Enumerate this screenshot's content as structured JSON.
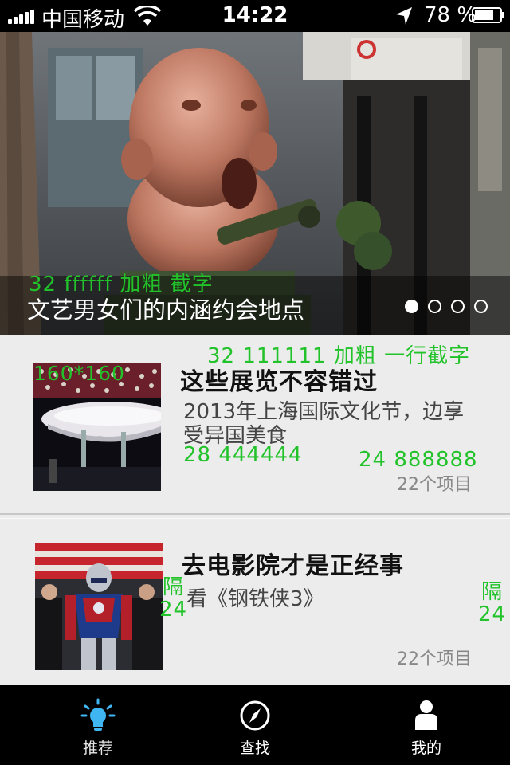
{
  "status_bar": {
    "carrier": "中国移动",
    "time": "14:22",
    "battery": "78 %"
  },
  "banner": {
    "note": "32 ffffff 加粗 截字",
    "title": "文艺男女们的内涵约会地点",
    "page_count": 4,
    "active_page": 1
  },
  "list": {
    "items": [
      {
        "title": "这些展览不容错过",
        "desc": "2013年上海国际文化节，边享受异国美食",
        "count": "22个项目",
        "notes": {
          "title": "32 111111 加粗 一行截字",
          "thumb": "160*160",
          "desc": "28 444444",
          "count": "24 888888"
        }
      },
      {
        "title": "去电影院才是正经事",
        "desc": "看《钢铁侠3》",
        "count": "22个项目",
        "notes": {
          "gap_left_1": "隔",
          "gap_left_2": "24",
          "gap_right_1": "隔",
          "gap_right_2": "24"
        }
      }
    ]
  },
  "tab_bar": {
    "tabs": [
      {
        "label": "推荐",
        "icon": "lightbulb-icon",
        "active": true
      },
      {
        "label": "查找",
        "icon": "compass-icon",
        "active": false
      },
      {
        "label": "我的",
        "icon": "person-icon",
        "active": false
      }
    ]
  },
  "colors": {
    "annotation": "#22c32a",
    "title_text": "#111111",
    "desc_text": "#444444",
    "count_text": "#888888",
    "active_tab_icon": "#3fb6f2"
  }
}
